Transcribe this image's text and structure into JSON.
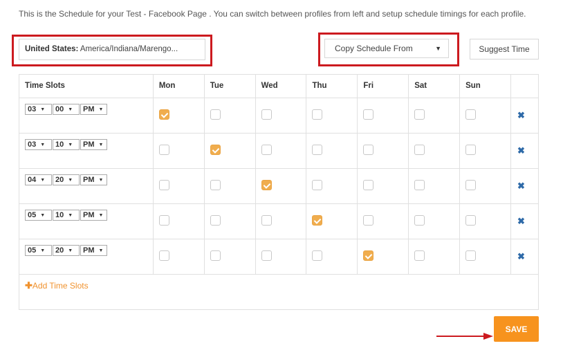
{
  "intro_text": "This is the Schedule for your Test - Facebook Page . You can switch between profiles from left and setup schedule timings for each profile.",
  "timezone": {
    "country_label": "United States:",
    "zone": "America/Indiana/Marengo..."
  },
  "copy_schedule": {
    "label": "Copy Schedule From"
  },
  "suggest_time": {
    "label": "Suggest Time"
  },
  "table": {
    "headers": [
      "Time Slots",
      "Mon",
      "Tue",
      "Wed",
      "Thu",
      "Fri",
      "Sat",
      "Sun"
    ],
    "rows": [
      {
        "hour": "03",
        "minute": "00",
        "ampm": "PM",
        "days": [
          true,
          false,
          false,
          false,
          false,
          false,
          false
        ]
      },
      {
        "hour": "03",
        "minute": "10",
        "ampm": "PM",
        "days": [
          false,
          true,
          false,
          false,
          false,
          false,
          false
        ]
      },
      {
        "hour": "04",
        "minute": "20",
        "ampm": "PM",
        "days": [
          false,
          false,
          true,
          false,
          false,
          false,
          false
        ]
      },
      {
        "hour": "05",
        "minute": "10",
        "ampm": "PM",
        "days": [
          false,
          false,
          false,
          true,
          false,
          false,
          false
        ]
      },
      {
        "hour": "05",
        "minute": "20",
        "ampm": "PM",
        "days": [
          false,
          false,
          false,
          false,
          true,
          false,
          false
        ]
      }
    ],
    "add_label": "Add Time Slots"
  },
  "save": {
    "label": "SAVE"
  },
  "icons": {
    "dropdown": "▼",
    "select_caret": "▼",
    "delete": "✖",
    "plus": "✚"
  },
  "colors": {
    "accent": "#f7931e",
    "checkbox_on": "#f0ad4e",
    "highlight": "#cc1a1f",
    "delete": "#2e6aa8"
  }
}
